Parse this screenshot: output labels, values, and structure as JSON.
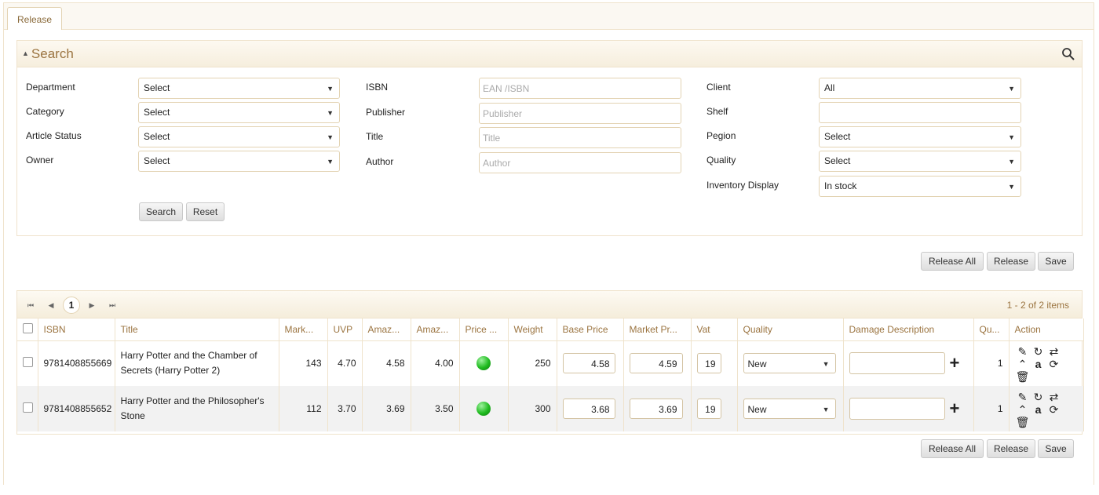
{
  "tab": {
    "label": "Release"
  },
  "search": {
    "title": "Search",
    "fields": {
      "department": {
        "label": "Department",
        "value": "Select"
      },
      "category": {
        "label": "Category",
        "value": "Select"
      },
      "article_status": {
        "label": "Article Status",
        "value": "Select"
      },
      "owner": {
        "label": "Owner",
        "value": "Select"
      },
      "isbn": {
        "label": "ISBN",
        "placeholder": "EAN /ISBN"
      },
      "publisher": {
        "label": "Publisher",
        "placeholder": "Publisher"
      },
      "title": {
        "label": "Title",
        "placeholder": "Title"
      },
      "author": {
        "label": "Author",
        "placeholder": "Author"
      },
      "client": {
        "label": "Client",
        "value": "All"
      },
      "shelf": {
        "label": "Shelf",
        "value": ""
      },
      "region": {
        "label": "Pegion",
        "value": "Select"
      },
      "quality": {
        "label": "Quality",
        "value": "Select"
      },
      "inventory_display": {
        "label": "Inventory Display",
        "value": "In stock"
      }
    },
    "search_button": "Search",
    "reset_button": "Reset"
  },
  "toolbar": {
    "release_all": "Release All",
    "release": "Release",
    "save": "Save"
  },
  "pager": {
    "current_page": "1",
    "info": "1 - 2 of 2 items",
    "first": "⏮",
    "prev": "◀",
    "next": "▶",
    "last": "⏭"
  },
  "columns": [
    "ISBN",
    "Title",
    "Mark...",
    "UVP",
    "Amaz...",
    "Amaz...",
    "Price ...",
    "Weight",
    "Base Price",
    "Market Pr...",
    "Vat",
    "Quality",
    "Damage Description",
    "Qu...",
    "Action"
  ],
  "rows": [
    {
      "isbn": "9781408855669",
      "title": "Harry Potter and the Chamber of Secrets (Harry Potter 2)",
      "market": "143",
      "uvp": "4.70",
      "amazon1": "4.58",
      "amazon2": "4.00",
      "price_status_color": "#1fbb1f",
      "weight": "250",
      "base_price": "4.58",
      "market_price": "4.59",
      "vat": "19",
      "quality": "New",
      "damage": "",
      "qty": "1"
    },
    {
      "isbn": "9781408855652",
      "title": "Harry Potter and the Philosopher's Stone",
      "market": "112",
      "uvp": "3.70",
      "amazon1": "3.69",
      "amazon2": "3.50",
      "price_status_color": "#1fbb1f",
      "weight": "300",
      "base_price": "3.68",
      "market_price": "3.69",
      "vat": "19",
      "quality": "New",
      "damage": "",
      "qty": "1"
    }
  ],
  "action_icons": [
    "edit-icon",
    "refresh-icon",
    "swap-icon",
    "up-icon",
    "amazon-icon",
    "sync-icon",
    "delete-icon"
  ],
  "colors": {
    "accent": "#9b7440",
    "border": "#efe3cc",
    "status_ok": "#1fbb1f"
  }
}
